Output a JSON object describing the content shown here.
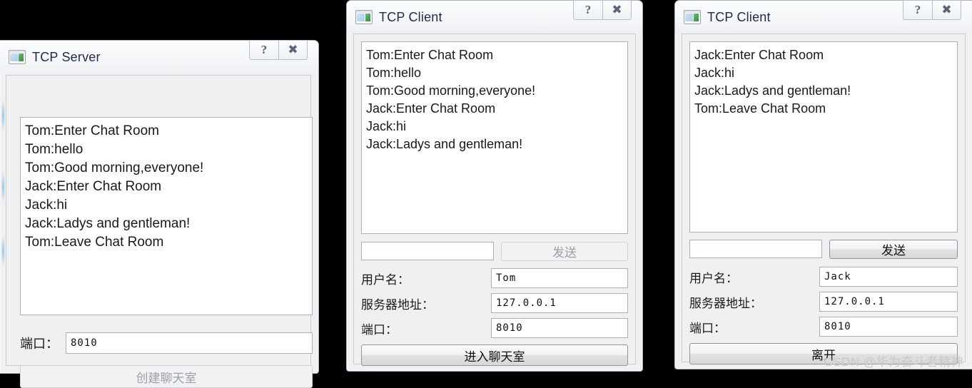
{
  "background_color": "#000000",
  "windows": [
    {
      "id": "tcp-server",
      "title": "TCP Server",
      "icon": "application-window-icon",
      "titlebar_buttons": [
        {
          "name": "help-button",
          "glyph": "?"
        },
        {
          "name": "close-button",
          "glyph": "✖"
        }
      ],
      "messages": [
        "Tom:Enter Chat Room",
        "Tom:hello",
        "Tom:Good morning,everyone!",
        "Jack:Enter Chat Room",
        "Jack:hi",
        "Jack:Ladys and gentleman!",
        "Tom:Leave Chat Room"
      ],
      "port_label": "端口：",
      "port_value": "8010",
      "create_button_label": "创建聊天室",
      "create_button_state": "disabled"
    },
    {
      "id": "tcp-client-tom",
      "title": "TCP Client",
      "icon": "application-window-icon",
      "titlebar_buttons": [
        {
          "name": "help-button",
          "glyph": "?"
        },
        {
          "name": "close-button",
          "glyph": "✖"
        }
      ],
      "messages": [
        "Tom:Enter Chat Room",
        "Tom:hello",
        "Tom:Good morning,everyone!",
        "Jack:Enter Chat Room",
        "Jack:hi",
        "Jack:Ladys and gentleman!"
      ],
      "message_input_value": "",
      "send_button_label": "发送",
      "send_button_state": "disabled",
      "username_label": "用户名：",
      "username_value": "Tom",
      "server_address_label": "服务器地址：",
      "server_address_value": "127.0.0.1",
      "port_label": "端口：",
      "port_value": "8010",
      "main_button_label": "进入聊天室",
      "main_button_state": "enabled"
    },
    {
      "id": "tcp-client-jack",
      "title": "TCP Client",
      "icon": "application-window-icon",
      "titlebar_buttons": [
        {
          "name": "help-button",
          "glyph": "?"
        },
        {
          "name": "close-button",
          "glyph": "✖"
        }
      ],
      "messages": [
        "Jack:Enter Chat Room",
        "Jack:hi",
        "Jack:Ladys and gentleman!",
        "Tom:Leave Chat Room"
      ],
      "message_input_value": "",
      "send_button_label": "发送",
      "send_button_state": "enabled",
      "username_label": "用户名：",
      "username_value": "Jack",
      "server_address_label": "服务器地址：",
      "server_address_value": "127.0.0.1",
      "port_label": "端口：",
      "port_value": "8010",
      "main_button_label": "离开",
      "main_button_state": "enabled"
    }
  ],
  "watermark": "CSDN @华为奋斗者精神"
}
